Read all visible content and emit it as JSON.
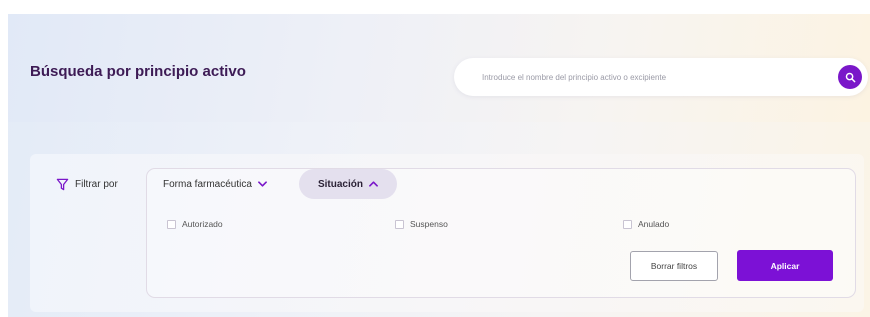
{
  "header": {
    "title": "Búsqueda por principio activo",
    "search_placeholder": "Introduce el nombre del principio activo o excipiente",
    "search_icon": "search-icon"
  },
  "filters": {
    "label": "Filtrar por",
    "label_icon": "funnel-icon",
    "tabs": [
      {
        "label": "Forma farmacéutica",
        "icon": "chevron-down-icon",
        "expanded": false
      },
      {
        "label": "Situación",
        "icon": "chevron-up-icon",
        "expanded": true
      }
    ],
    "options": [
      {
        "label": "Autorizado",
        "checked": false
      },
      {
        "label": "Suspenso",
        "checked": false
      },
      {
        "label": "Anulado",
        "checked": false
      }
    ],
    "clear_label": "Borrar filtros",
    "apply_label": "Aplicar"
  },
  "colors": {
    "accent": "#7c11d6",
    "title": "#3d1b55",
    "active_tab_bg": "#e4e0ee"
  }
}
